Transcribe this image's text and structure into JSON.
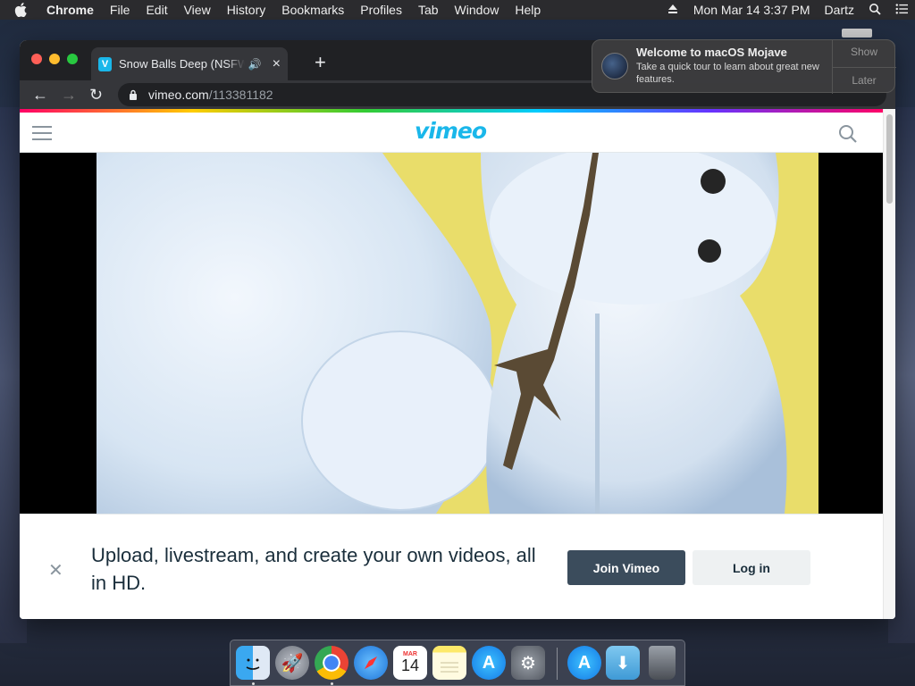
{
  "menubar": {
    "app_name": "Chrome",
    "items": [
      "File",
      "Edit",
      "View",
      "History",
      "Bookmarks",
      "Profiles",
      "Tab",
      "Window",
      "Help"
    ],
    "datetime": "Mon Mar 14  3:37 PM",
    "user": "Dartz"
  },
  "browser": {
    "tab_title": "Snow Balls Deep (NSFW) o",
    "url_host": "vimeo.com",
    "url_path": "/113381182"
  },
  "vimeo": {
    "logo": "vimeo",
    "brand_color": "#1ab7ea",
    "banner_message": "Upload, livestream, and create your own videos, all in HD.",
    "join_label": "Join Vimeo",
    "login_label": "Log in"
  },
  "notification": {
    "title": "Welcome to macOS Mojave",
    "body": "Take a quick tour to learn about great new features.",
    "show_label": "Show",
    "later_label": "Later"
  },
  "dock": {
    "calendar_month": "MAR",
    "calendar_day": "14",
    "apps": [
      "finder-icon",
      "launchpad-icon",
      "chrome-icon",
      "safari-icon",
      "calendar-icon",
      "notes-icon",
      "app-store-icon",
      "system-preferences-icon",
      "app-store-alt-icon",
      "downloads-folder-icon",
      "trash-icon"
    ]
  }
}
